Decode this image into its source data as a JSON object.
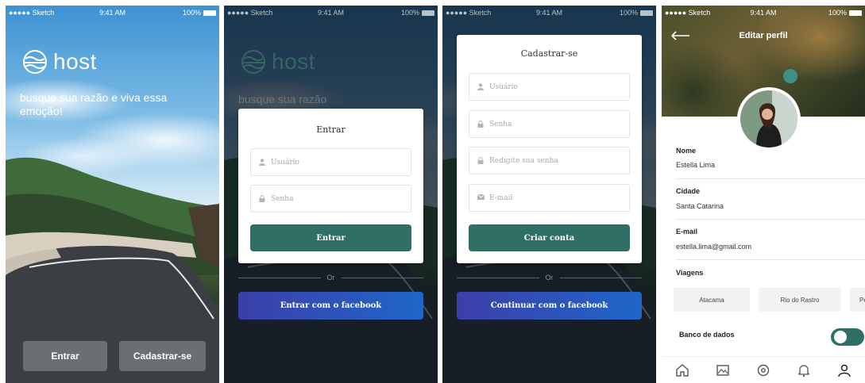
{
  "status": {
    "carrier": "●●●●● Sketch",
    "time": "9:41 AM",
    "battery": "100%"
  },
  "welcome": {
    "logo_text": "host",
    "tagline": "busque sua razão e viva essa emoção!",
    "login_button": "Entrar",
    "signup_button": "Cadastrar-se"
  },
  "login": {
    "title": "Entrar",
    "user_placeholder": "Usuário",
    "password_placeholder": "Senha",
    "submit": "Entrar",
    "or": "Or",
    "facebook": "Entrar com o facebook",
    "bg_logo": "host",
    "bg_tagline": "busque sua razão"
  },
  "signup": {
    "title": "Cadastrar-se",
    "user_placeholder": "Usuário",
    "password_placeholder": "Senha",
    "repeat_placeholder": "Redigite sua senha",
    "email_placeholder": "E-mail",
    "submit": "Criar conta",
    "or": "Or",
    "facebook": "Continuar com o facebook"
  },
  "profile": {
    "title": "Editar perfil",
    "name_label": "Nome",
    "name_value": "Estella Lima",
    "city_label": "Cidade",
    "city_value": "Santa Catarina",
    "email_label": "E-mail",
    "email_value": "estella.lima@gmail.com",
    "trips_label": "Viagens",
    "trips": [
      "Atacama",
      "Rio do Rastro",
      "Pe"
    ],
    "db_label": "Banco de dados",
    "tabs": [
      "home-icon",
      "gallery-icon",
      "location-icon",
      "bell-icon",
      "user-icon"
    ]
  },
  "colors": {
    "primary": "#2f6f66",
    "facebook_start": "#3c3fa8",
    "facebook_end": "#1f66c9"
  }
}
